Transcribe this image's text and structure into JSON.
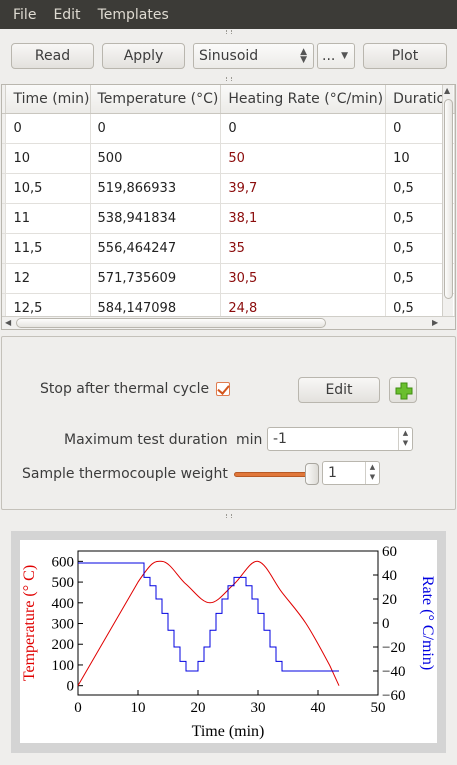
{
  "menu": [
    "File",
    "Edit",
    "Templates"
  ],
  "toolbar": {
    "read_label": "Read",
    "apply_label": "Apply",
    "template_value": "Sinusoid",
    "more_value": "...",
    "plot_label": "Plot"
  },
  "table": {
    "columns": [
      "Time (min)",
      "Temperature (°C)",
      "Heating Rate (°C/min)",
      "Duration"
    ],
    "rows": [
      [
        "0",
        "0",
        "0",
        "0"
      ],
      [
        "10",
        "500",
        "50",
        "10"
      ],
      [
        "10,5",
        "519,866933",
        "39,7",
        "0,5"
      ],
      [
        "11",
        "538,941834",
        "38,1",
        "0,5"
      ],
      [
        "11,5",
        "556,464247",
        "35",
        "0,5"
      ],
      [
        "12",
        "571,735609",
        "30,5",
        "0,5"
      ],
      [
        "12,5",
        "584,147098",
        "24,8",
        "0,5"
      ]
    ]
  },
  "settings": {
    "stop_label": "Stop after thermal cycle",
    "stop_checked": true,
    "edit_label": "Edit",
    "max_duration_label": "Maximum test duration",
    "max_duration_unit": "min",
    "max_duration_value": "-1",
    "tc_weight_label": "Sample thermocouple weight",
    "tc_weight_value": "1"
  },
  "chart_data": {
    "type": "line",
    "xlabel": "Time (min)",
    "ylabel": "Temperature (° C)",
    "y2label": "Rate (° C/min)",
    "xlim": [
      0,
      50
    ],
    "ylim": [
      -45,
      650
    ],
    "y2lim": [
      -60,
      60
    ],
    "xticks": [
      0,
      10,
      20,
      30,
      40,
      50
    ],
    "yticks": [
      0,
      100,
      200,
      300,
      400,
      500,
      600
    ],
    "y2ticks": [
      -60,
      -40,
      -20,
      0,
      20,
      40,
      60
    ],
    "colors": {
      "temperature": "#e00000",
      "rate": "#0000e0"
    },
    "series": [
      {
        "x": [
          0,
          10,
          14,
          18,
          22,
          26,
          30,
          34,
          38,
          42,
          43.5
        ],
        "y": [
          0,
          500,
          600,
          490,
          400,
          490,
          600,
          450,
          300,
          95,
          0
        ]
      },
      {
        "x": [
          0,
          10,
          11,
          12,
          13,
          14,
          15,
          16,
          17,
          18,
          19,
          20,
          21,
          22,
          23,
          24,
          25,
          26,
          27,
          28,
          29,
          30,
          31,
          32,
          33,
          34,
          43.5
        ],
        "y": [
          50,
          50,
          38,
          31,
          20,
          8,
          -6,
          -20,
          -32,
          -40,
          -40,
          -32,
          -20,
          -6,
          8,
          20,
          31,
          38,
          38,
          31,
          20,
          8,
          -6,
          -20,
          -32,
          -40,
          -40
        ]
      }
    ]
  }
}
